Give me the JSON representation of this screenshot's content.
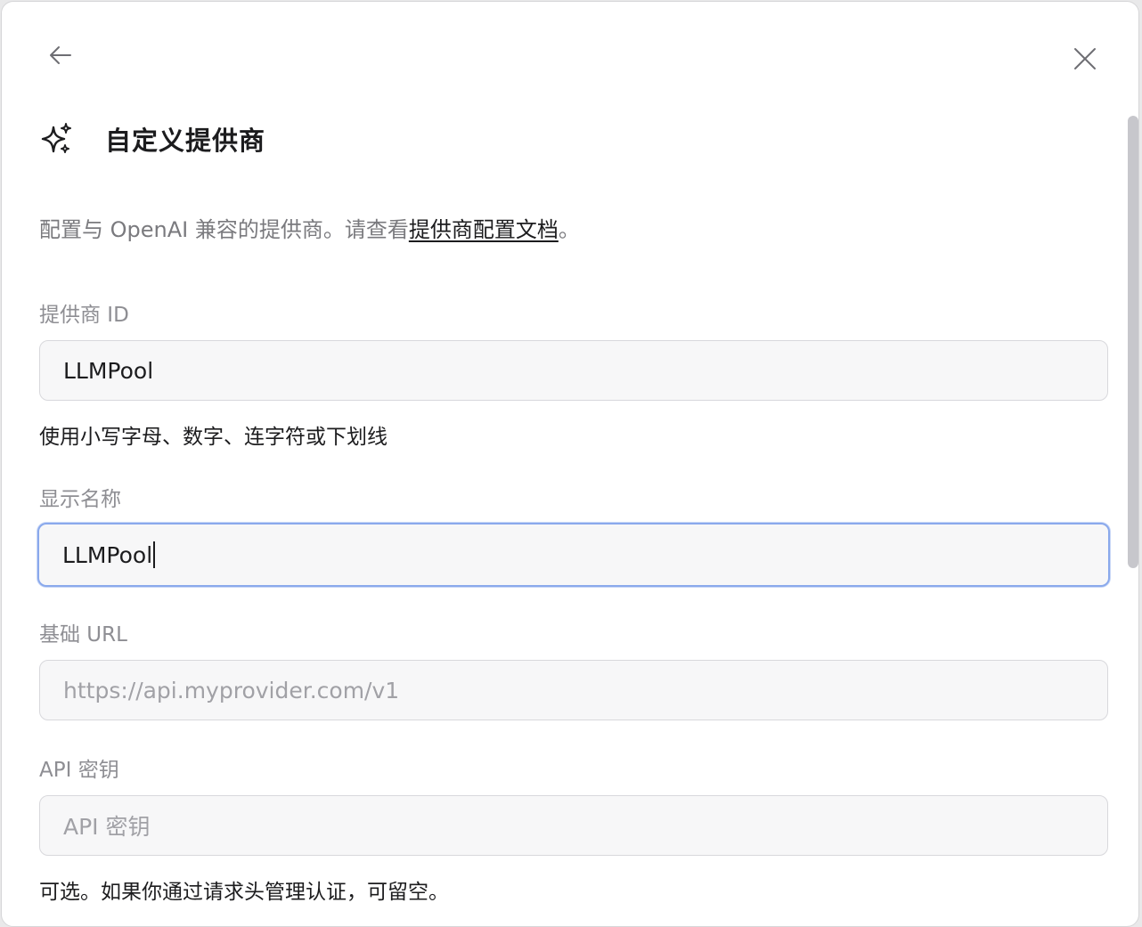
{
  "dialog": {
    "title": "自定义提供商",
    "description_prefix": "配置与 OpenAI 兼容的提供商。请查看",
    "description_link": "提供商配置文档",
    "description_suffix": "。"
  },
  "icons": {
    "back": "arrow-left-icon",
    "close": "close-icon",
    "title": "sparkles-icon"
  },
  "fields": {
    "provider_id": {
      "label": "提供商 ID",
      "value": "LLMPool",
      "hint": "使用小写字母、数字、连字符或下划线"
    },
    "display_name": {
      "label": "显示名称",
      "value": "LLMPool"
    },
    "base_url": {
      "label": "基础 URL",
      "placeholder": "https://api.myprovider.com/v1"
    },
    "api_key": {
      "label": "API 密钥",
      "placeholder": "API 密钥",
      "hint": "可选。如果你通过请求头管理认证，可留空。"
    }
  },
  "colors": {
    "focus_border": "#8aa9ec",
    "text_primary": "#1c1c1e",
    "text_secondary": "#8e8e93"
  }
}
